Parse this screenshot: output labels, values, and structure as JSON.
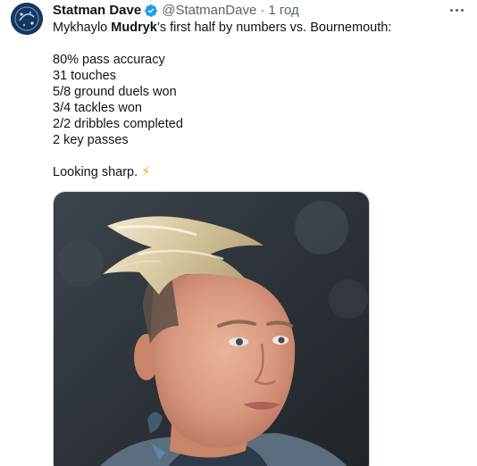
{
  "author": {
    "display_name": "Statman Dave",
    "handle": "@StatmanDave",
    "separator": "·",
    "time": "1 год",
    "verified": true
  },
  "tweet": {
    "intro_before": "Mykhaylo ",
    "intro_bold": "Mudryk",
    "intro_after": "’s first half by numbers vs. Bournemouth:",
    "stats": [
      "80% pass accuracy",
      "31 touches",
      "5/8 ground duels won",
      "3/4 tackles won",
      "2/2 dribbles completed",
      "2 key passes"
    ],
    "closing": "Looking sharp. ",
    "closing_emoji": "⚡"
  },
  "colors": {
    "verified_badge": "#1d9bf0",
    "secondary_text": "#536471",
    "primary_text": "#0f1419"
  },
  "icons": {
    "avatar": "statman-dave-avatar",
    "verified": "verified-badge-icon",
    "more": "more-options-icon"
  }
}
